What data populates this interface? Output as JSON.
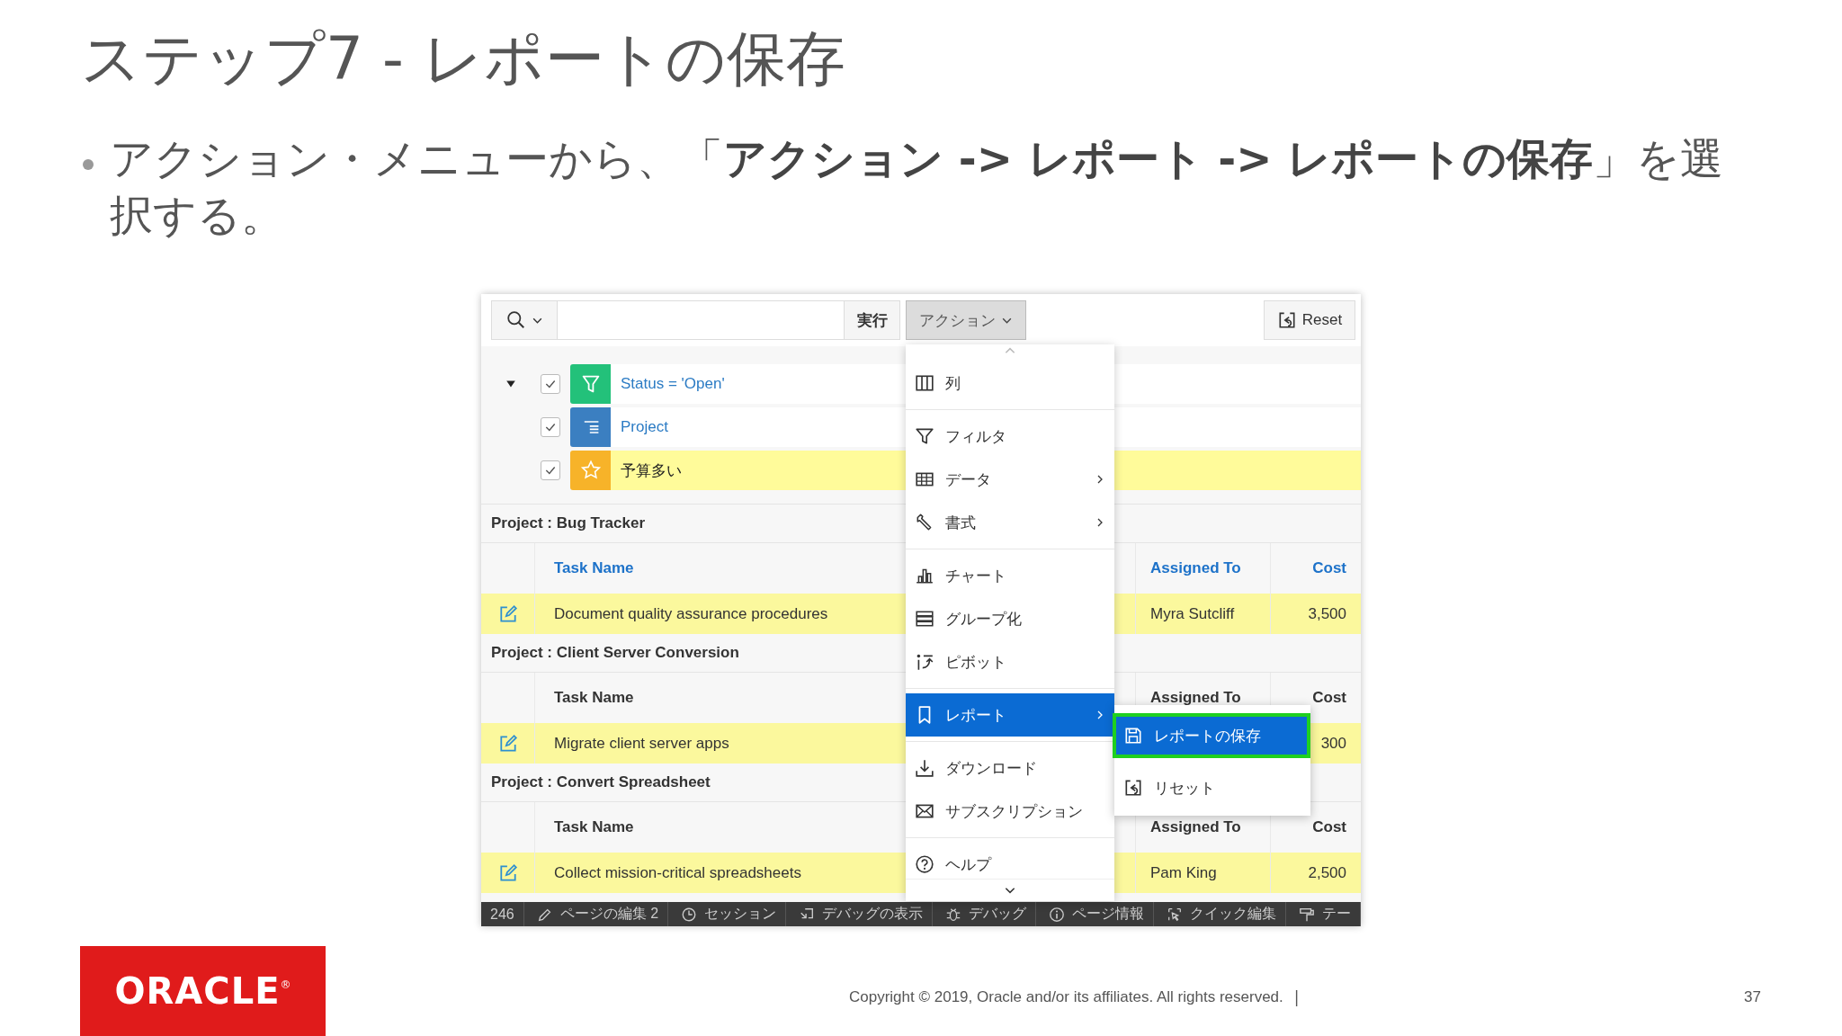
{
  "slide": {
    "title": "ステップ7 - レポートの保存",
    "bullet": "アクション・メニューから、「**アクション -> レポート -> レポートの保存**」を選択する。"
  },
  "app": {
    "toolbar": {
      "go_label": "実行",
      "actions_label": "アクション",
      "reset_label": "Reset"
    },
    "filters_expanded": true,
    "filters": [
      {
        "kind": "filter",
        "label": "Status = 'Open'",
        "checked": true,
        "color": "#23c17a"
      },
      {
        "kind": "group",
        "label": "Project",
        "checked": true,
        "color": "#3b7fc1"
      },
      {
        "kind": "highlight",
        "label": "予算多い",
        "checked": true,
        "color": "#f7b329"
      }
    ],
    "groups": [
      {
        "title": "Project : Bug Tracker",
        "headers_active": true,
        "columns": [
          "Task Name",
          "Assigned To",
          "Cost"
        ],
        "rows": [
          {
            "task": "Document quality assurance procedures",
            "assigned": "Myra Sutcliff",
            "cost": "3,500",
            "highlighted": true
          }
        ]
      },
      {
        "title": "Project : Client Server Conversion",
        "headers_active": false,
        "columns": [
          "Task Name",
          "Assigned To",
          "Cost"
        ],
        "rows": [
          {
            "task": "Migrate client server apps",
            "cost": "300",
            "highlighted": true
          }
        ]
      },
      {
        "title": "Project : Convert Spreadsheet",
        "headers_active": false,
        "columns": [
          "Task Name",
          "Assigned To",
          "Cost"
        ],
        "rows": [
          {
            "task": "Collect mission-critical spreadsheets",
            "assigned": "Pam King",
            "cost": "2,500",
            "highlighted": true
          }
        ]
      }
    ],
    "menu": {
      "sections": [
        [
          {
            "label": "列",
            "submenu": false,
            "selected": false
          }
        ],
        [
          {
            "label": "フィルタ",
            "submenu": false,
            "selected": false
          },
          {
            "label": "データ",
            "submenu": true,
            "selected": false
          },
          {
            "label": "書式",
            "submenu": true,
            "selected": false
          }
        ],
        [
          {
            "label": "チャート",
            "submenu": false,
            "selected": false
          },
          {
            "label": "グループ化",
            "submenu": false,
            "selected": false
          },
          {
            "label": "ピボット",
            "submenu": false,
            "selected": false
          }
        ],
        [
          {
            "label": "レポート",
            "submenu": true,
            "selected": true
          }
        ],
        [
          {
            "label": "ダウンロード",
            "submenu": false,
            "selected": false
          },
          {
            "label": "サブスクリプション",
            "submenu": false,
            "selected": false
          }
        ],
        [
          {
            "label": "ヘルプ",
            "submenu": false,
            "selected": false
          }
        ]
      ]
    },
    "submenu": [
      {
        "label": "レポートの保存",
        "selected": true
      },
      {
        "label": "リセット",
        "selected": false
      }
    ],
    "dev_bar": [
      {
        "label": "246"
      },
      {
        "label": "ページの編集 2"
      },
      {
        "label": "セッション"
      },
      {
        "label": "デバッグの表示"
      },
      {
        "label": "デバッグ"
      },
      {
        "label": "ページ情報"
      },
      {
        "label": "クイック編集"
      },
      {
        "label": "テー"
      }
    ]
  },
  "footer": {
    "logo": "ORACLE",
    "logo_mark": "®",
    "copyright": "Copyright © 2019, Oracle and/or its affiliates. All rights reserved.",
    "separator": "|",
    "page_number": "37"
  }
}
